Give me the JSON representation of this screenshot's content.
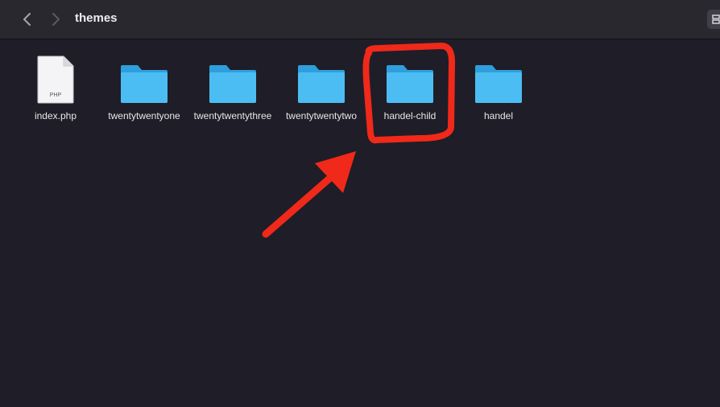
{
  "window": {
    "title": "themes"
  },
  "toolbar": {
    "back_icon": "chevron-left-icon",
    "forward_icon": "chevron-right-icon",
    "view_icon": "grid-view-icon"
  },
  "items": [
    {
      "label": "index.php",
      "kind": "file",
      "badge": "PHP"
    },
    {
      "label": "twentytwentyone",
      "kind": "folder"
    },
    {
      "label": "twentytwentythree",
      "kind": "folder"
    },
    {
      "label": "twentytwentytwo",
      "kind": "folder"
    },
    {
      "label": "handel-child",
      "kind": "folder"
    },
    {
      "label": "handel",
      "kind": "folder"
    }
  ],
  "colors": {
    "background": "#1f1d27",
    "toolbar": "#2a282f",
    "folder_front": "#4cbdf2",
    "folder_back": "#2e9fdc",
    "annotation": "#f0291a"
  }
}
